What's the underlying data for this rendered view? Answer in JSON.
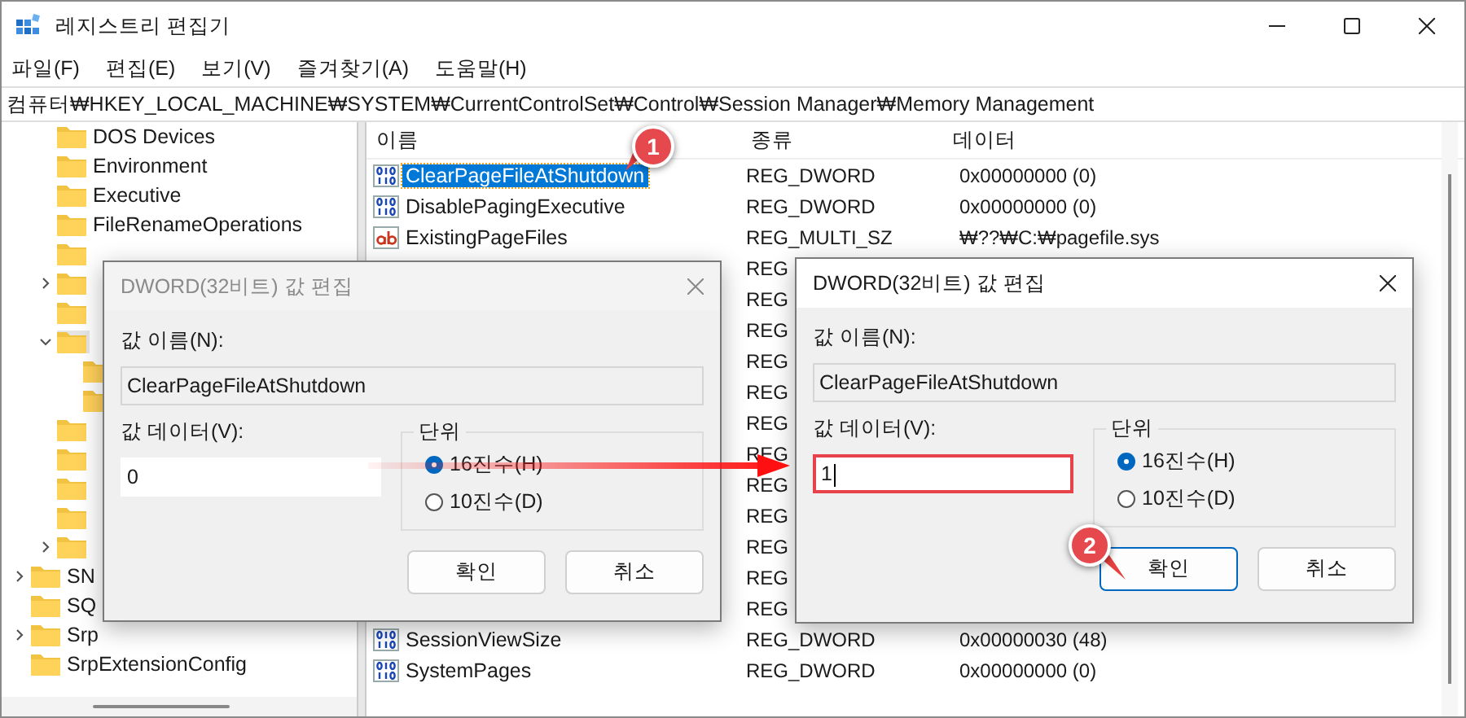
{
  "window": {
    "title": "레지스트리 편집기"
  },
  "menu": [
    "파일(F)",
    "편집(E)",
    "보기(V)",
    "즐겨찾기(A)",
    "도움말(H)"
  ],
  "address": "컴퓨터₩HKEY_LOCAL_MACHINE₩SYSTEM₩CurrentControlSet₩Control₩Session Manager₩Memory Management",
  "tree": {
    "items": [
      {
        "children": [
          {
            "label": "DOS Devices",
            "selected": false
          },
          {
            "label": "Environment",
            "selected": false
          },
          {
            "label": "Executive",
            "selected": false
          },
          {
            "label": "FileRenameOperations",
            "selected": false
          },
          {
            "kind": "folder",
            "selected": false
          },
          {
            "kind": "folder",
            "expanded": false,
            "selected": false
          },
          {
            "kind": "folder",
            "selected": false
          },
          {
            "kind": "folder",
            "expanded": true,
            "selected": true,
            "children": [
              {
                "kind": "folder",
                "selected": false
              },
              {
                "kind": "folder",
                "selected": false
              }
            ]
          },
          {
            "kind": "folder",
            "selected": false
          },
          {
            "kind": "folder",
            "selected": false
          },
          {
            "kind": "folder",
            "selected": false
          },
          {
            "kind": "folder",
            "selected": false
          },
          {
            "kind": "folder",
            "expanded": false,
            "selected": false
          }
        ]
      },
      {
        "label": "SN",
        "expanded": false,
        "selected": false
      },
      {
        "label": "SQ",
        "selected": false
      },
      {
        "label": "Srp",
        "expanded": false,
        "selected": false
      },
      {
        "label": "SrpExtensionConfig",
        "selected": false
      }
    ]
  },
  "table": {
    "columns": [
      "이름",
      "종류",
      "데이터"
    ],
    "rows": [
      {
        "kind": "dword",
        "name": "ClearPageFileAtShutdown",
        "type": "REG_DWORD",
        "data": "0x00000000 (0)",
        "selected": true
      },
      {
        "kind": "dword",
        "name": "DisablePagingExecutive",
        "type": "REG_DWORD",
        "data": "0x00000000 (0)",
        "selected": false
      },
      {
        "kind": "string",
        "name": "ExistingPageFiles",
        "type": "REG_MULTI_SZ",
        "data": "₩??₩C:₩pagefile.sys",
        "selected": false
      },
      {
        "type": "REG"
      },
      {
        "type": "REG"
      },
      {
        "type": "REG"
      },
      {
        "type": "REG"
      },
      {
        "type": "REG"
      },
      {
        "type": "REG"
      },
      {
        "type": "REG"
      },
      {
        "type": "REG"
      },
      {
        "type": "REG"
      },
      {
        "type": "REG"
      },
      {
        "type": "REG"
      },
      {
        "type": "REG"
      },
      {
        "kind": "dword",
        "name": "SessionViewSize",
        "type": "REG_DWORD",
        "data": "0x00000030 (48)",
        "selected": false
      },
      {
        "kind": "dword",
        "name": "SystemPages",
        "type": "REG_DWORD",
        "data": "0x00000000 (0)",
        "selected": false
      }
    ]
  },
  "dialogs": [
    {
      "title": "DWORD(32비트) 값 편집",
      "active": false,
      "name_label": "값 이름(N):",
      "name_value": "ClearPageFileAtShutdown",
      "data_label": "값 데이터(V):",
      "data_value": "0",
      "highlighted": false,
      "unit_label": "단위",
      "radios": [
        {
          "label": "16진수(H)",
          "selected": true
        },
        {
          "label": "10진수(D)",
          "selected": false
        }
      ],
      "buttons": [
        {
          "label": "확인",
          "focused": false
        },
        {
          "label": "취소",
          "focused": false
        }
      ]
    },
    {
      "title": "DWORD(32비트) 값 편집",
      "active": true,
      "name_label": "값 이름(N):",
      "name_value": "ClearPageFileAtShutdown",
      "data_label": "값 데이터(V):",
      "data_value": "1",
      "highlighted": true,
      "unit_label": "단위",
      "radios": [
        {
          "label": "16진수(H)",
          "selected": true
        },
        {
          "label": "10진수(D)",
          "selected": false
        }
      ],
      "buttons": [
        {
          "label": "확인",
          "focused": true
        },
        {
          "label": "취소",
          "focused": false
        }
      ]
    }
  ],
  "annotations": [
    {
      "label": "1"
    },
    {
      "label": "2"
    }
  ]
}
